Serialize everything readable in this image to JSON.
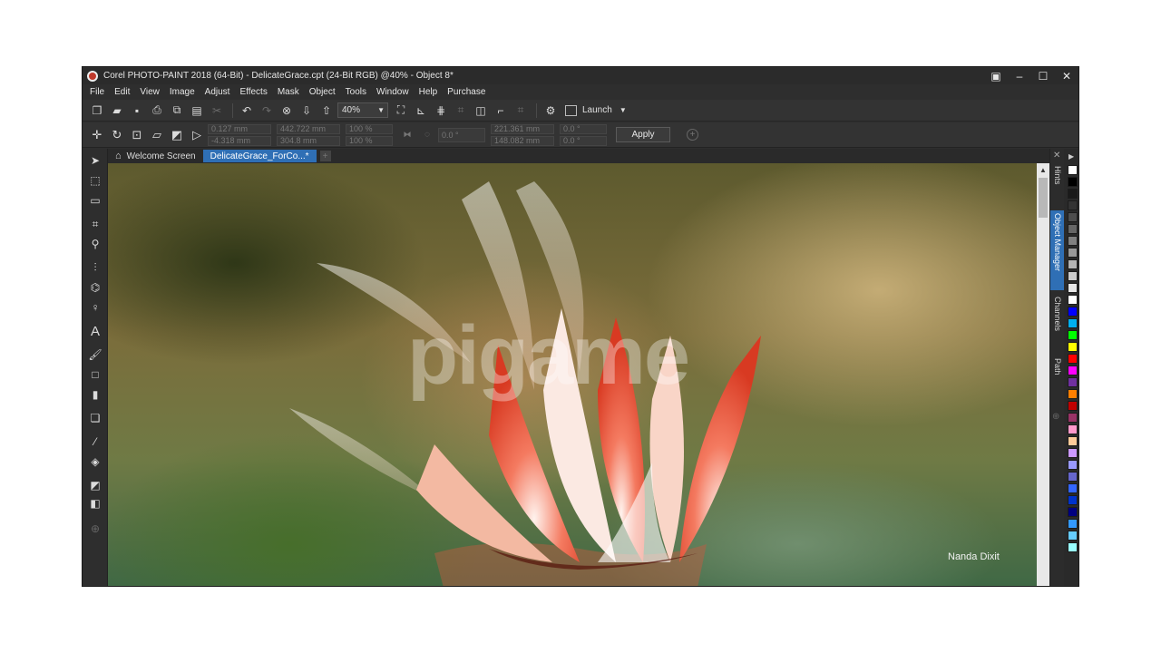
{
  "window": {
    "title": "Corel PHOTO-PAINT 2018 (64-Bit) - DelicateGrace.cpt (24-Bit RGB) @40% - Object 8*"
  },
  "menu": [
    "File",
    "Edit",
    "View",
    "Image",
    "Adjust",
    "Effects",
    "Mask",
    "Object",
    "Tools",
    "Window",
    "Help",
    "Purchase"
  ],
  "toolbar": {
    "zoom_value": "40%",
    "launch_label": "Launch"
  },
  "property_bar": {
    "pos_x": "0.127 mm",
    "pos_y": "-4.318 mm",
    "width": "442.722 mm",
    "height": "304.8 mm",
    "scale_x": "100 %",
    "scale_y": "100 %",
    "rotation": "0.0 °",
    "center_x": "221.361 mm",
    "center_y": "148.082 mm",
    "skew_x": "0.0 °",
    "skew_y": "0.0 °",
    "apply_label": "Apply"
  },
  "tabs": {
    "welcome": "Welcome Screen",
    "document": "DelicateGrace_ForCo...*"
  },
  "canvas": {
    "signature": "Nanda Dixit",
    "watermark": "pigame"
  },
  "dockers": [
    "Hints",
    "Object Manager",
    "Channels",
    "Path"
  ],
  "icons": {
    "close": "✕",
    "maximize": "☐",
    "minimize": "–"
  },
  "palette_colors": [
    "#ffffff",
    "#000000",
    "#1a1a1a",
    "#333333",
    "#4d4d4d",
    "#666666",
    "#808080",
    "#999999",
    "#b3b3b3",
    "#cccccc",
    "#e6e6e6",
    "#ffffff",
    "#0000ff",
    "#00b0f0",
    "#00ff00",
    "#ffff00",
    "#ff0000",
    "#ff00ff",
    "#7030a0",
    "#ff7f00",
    "#c00000",
    "#993366",
    "#ff99cc",
    "#ffcc99",
    "#cc99ff",
    "#9999ff",
    "#6666cc",
    "#3366ff",
    "#0033cc",
    "#000080",
    "#3399ff",
    "#66ccff",
    "#99ffff"
  ]
}
